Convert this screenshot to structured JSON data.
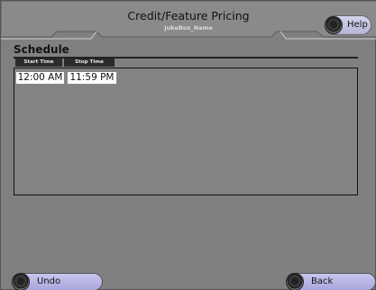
{
  "header": {
    "title": "Credit/Feature Pricing",
    "subtitle": "JukeBox_Name",
    "help_label": "Help"
  },
  "schedule": {
    "section_title": "Schedule",
    "columns": [
      "Start Time",
      "Stop Time"
    ],
    "rows": [
      {
        "start_time": "12:00 AM",
        "stop_time": "11:59 PM"
      }
    ]
  },
  "footer": {
    "undo_label": "Undo",
    "back_label": "Back"
  },
  "colors": {
    "background": "#808080",
    "button": "#b9b7e6",
    "header_cell": "#2b2b2b"
  },
  "icons": [
    "knob-icon"
  ]
}
